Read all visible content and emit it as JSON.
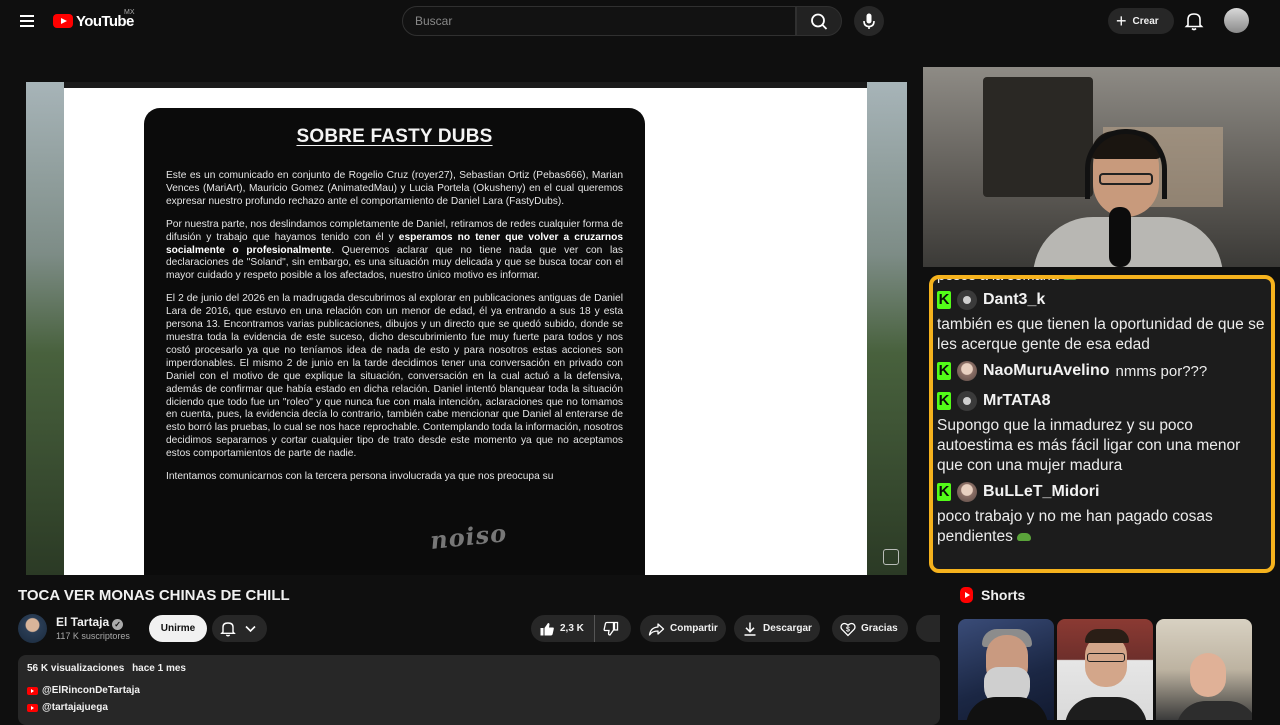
{
  "header": {
    "logo_text": "YouTube",
    "region": "MX",
    "search_placeholder": "Buscar",
    "create_label": "Crear"
  },
  "video": {
    "title": "TOCA VER MONAS CHINAS DE CHILL",
    "frame": {
      "doc_title": "SOBRE FASTY DUBS",
      "paragraphs": [
        "Este es un comunicado en conjunto de Rogelio Cruz (royer27), Sebastian Ortiz (Pebas666), Marian Vences (MariArt), Mauricio Gomez (AnimatedMau) y Lucia Portela (Okusheny) en el cual queremos expresar nuestro profundo rechazo ante el comportamiento de Daniel Lara (FastyDubs).",
        "Por nuestra parte, nos deslindamos completamente de Daniel, retiramos de redes cualquier forma de difusión y trabajo que hayamos tenido con él y esperamos no tener que volver a cruzarnos socialmente o profesionalmente. Queremos aclarar que no tiene nada que ver con las declaraciones de \"Soland\", sin embargo, es una situación muy delicada y que se busca tocar con el mayor cuidado y respeto posible a los afectados, nuestro único motivo es informar.",
        "El 2 de junio del 2026 en la madrugada descubrimos al explorar en publicaciones antiguas de Daniel Lara de 2016, que estuvo en una relación con un menor de edad, él ya entrando a sus 18 y esta persona 13. Encontramos varias publicaciones, dibujos y un directo que se quedó subido, donde se muestra toda la evidencia de este suceso, dicho descubrimiento fue muy fuerte para todos y nos costó procesarlo ya que no teníamos idea de nada de esto y para nosotros estas acciones son imperdonables. El mismo 2 de junio en la tarde decidimos tener una conversación en privado con Daniel con el motivo de que explique la situación, conversación en la cual actuó a la defensiva, además de confirmar que había estado en dicha relación. Daniel intentó blanquear toda la situación diciendo que todo fue un \"roleo\" y que nunca fue con mala intención, aclaraciones que no tomamos en cuenta, pues, la evidencia decía lo contrario, también cabe mencionar que Daniel al enterarse de esto borró las pruebas, lo cual se nos hace reprochable. Contemplando toda la información, nosotros decidimos separarnos y cortar cualquier tipo de trato desde este momento ya que no aceptamos estos comportamientos de parte de nadie.",
        "Intentamos comunicarnos con la tercera persona involucrada ya que nos preocupa su"
      ],
      "bold_phrase": "esperamos no tener que volver a cruzarnos socialmente o profesionalmente",
      "watermark": "noiso"
    }
  },
  "chat": {
    "cut_line": "pesos a la semana",
    "messages": [
      {
        "user": "Dant3_k",
        "text": "también es que tienen la oportunidad de que se les acerque gente de esa edad",
        "inline": ""
      },
      {
        "user": "NaoMuruAvelino",
        "text": "",
        "inline": "nmms por???"
      },
      {
        "user": "MrTATA8",
        "text": "Supongo que la inmadurez y su poco autoestima es más fácil ligar con una menor que con una mujer madura",
        "inline": ""
      },
      {
        "user": "BuLLeT_Midori",
        "text": "poco trabajo y no me han pagado cosas pendientes",
        "inline": ""
      }
    ],
    "accent_color": "#f5b21d",
    "kick_color": "#53fc18"
  },
  "channel": {
    "name": "El Tartaja",
    "subscribers": "117 K suscriptores",
    "join_label": "Unirme"
  },
  "actions": {
    "likes": "2,3 K",
    "share_label": "Compartir",
    "download_label": "Descargar",
    "thanks_label": "Gracias"
  },
  "description": {
    "views": "56 K visualizaciones",
    "age": "hace 1 mes",
    "links": [
      "@ElRinconDeTartaja",
      "@tartajajuega"
    ]
  },
  "shorts": {
    "title": "Shorts"
  }
}
